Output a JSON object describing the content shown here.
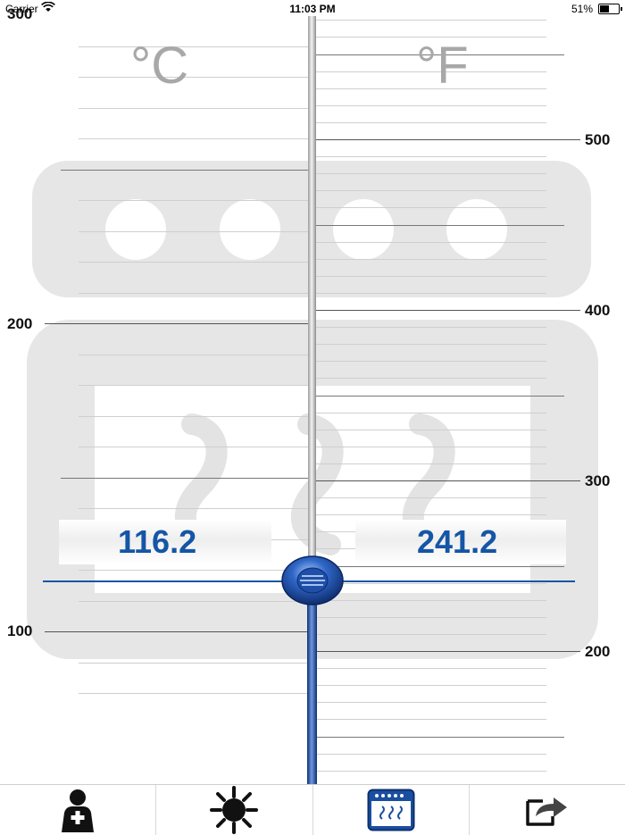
{
  "status_bar": {
    "carrier": "Carrier",
    "time": "11:03 PM",
    "battery": "51%"
  },
  "thermometer": {
    "celsius_unit": "°C",
    "fahrenheit_unit": "°F",
    "celsius_value": "116.2",
    "fahrenheit_value": "241.2",
    "celsius_reading": 116.2,
    "celsius_major_labels": [
      "300",
      "200",
      "100"
    ],
    "fahrenheit_major_labels": [
      "500",
      "400",
      "300",
      "200"
    ]
  },
  "tabs": [
    {
      "icon": "doctor-icon"
    },
    {
      "icon": "sun-icon"
    },
    {
      "icon": "oven-icon",
      "selected": true
    },
    {
      "icon": "share-icon"
    }
  ],
  "colors": {
    "accent": "#1555a6",
    "mercury": "#1a4fa0",
    "background_art": "#e6e6e6"
  }
}
